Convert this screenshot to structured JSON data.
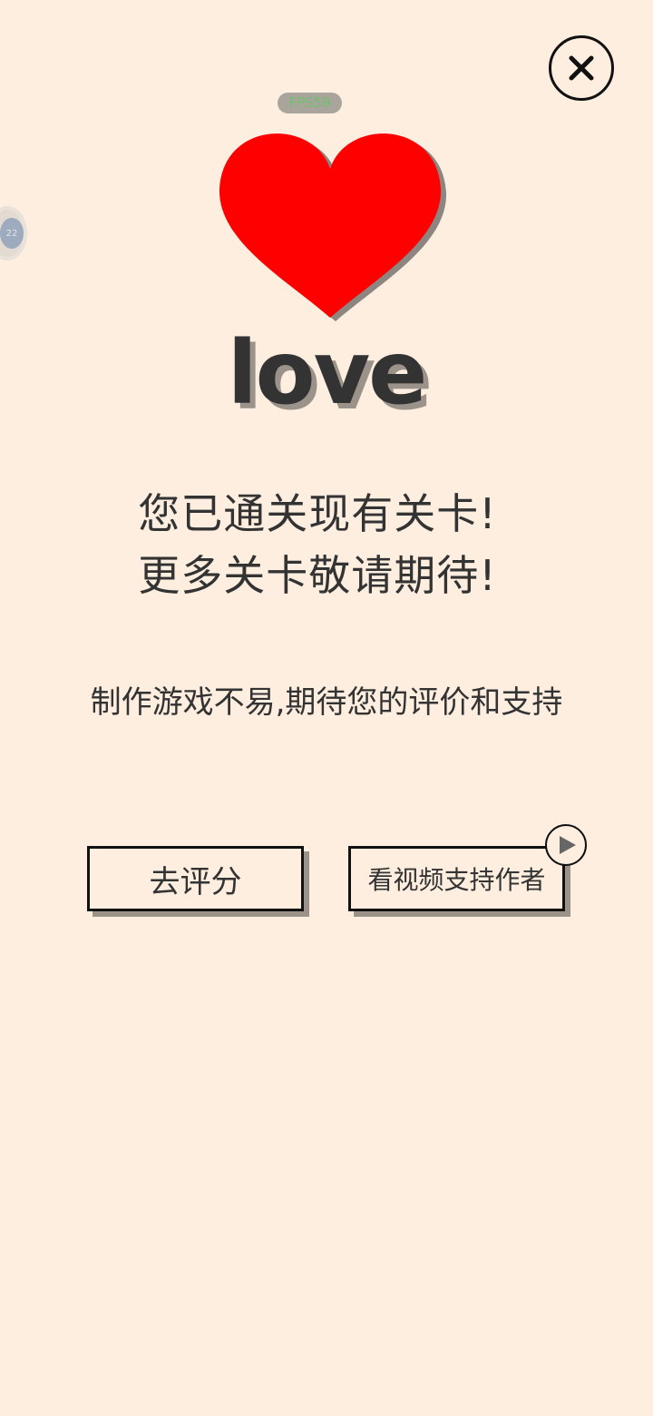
{
  "overlay": {
    "fps_label": "FPS59",
    "float_ball_text": "22"
  },
  "hero": {
    "word": "love",
    "heart_color": "#ff0000",
    "heart_shadow_color": "#8c8580"
  },
  "message": {
    "line1": "您已通关现有关卡!",
    "line2": "更多关卡敬请期待!",
    "support": "制作游戏不易,期待您的评价和支持"
  },
  "actions": {
    "rate_label": "去评分",
    "video_label": "看视频支持作者"
  },
  "icons": {
    "close": "close-icon",
    "play": "play-icon",
    "heart": "heart-icon"
  },
  "colors": {
    "background": "#fdeee0",
    "text": "#333333",
    "shadow": "#9b928a",
    "fps_text": "#6ec36b"
  }
}
